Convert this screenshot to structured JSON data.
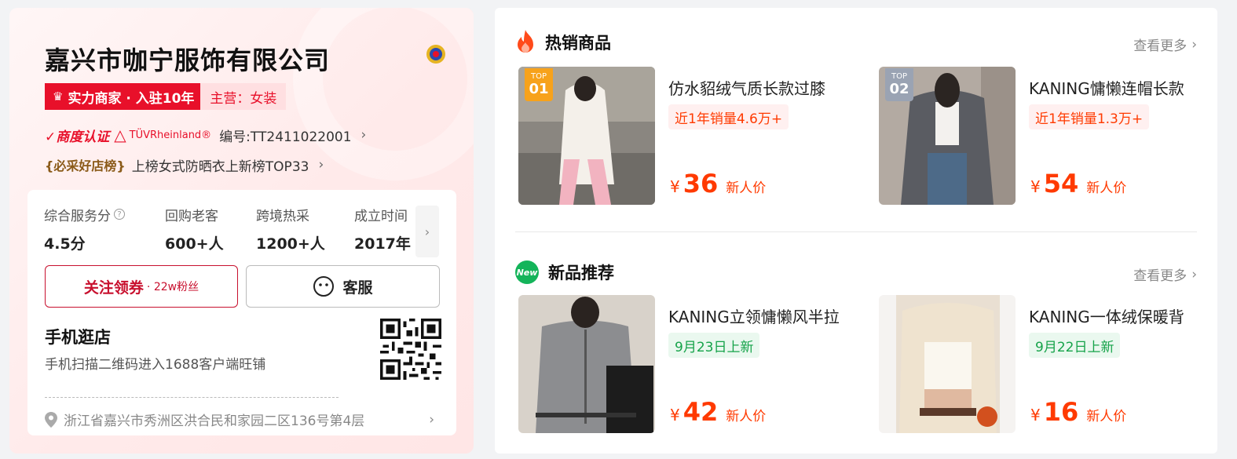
{
  "shop": {
    "name": "嘉兴市咖宁服饰有限公司",
    "strength_badge": "实力商家 · 入驻10年",
    "main_category": "主营：女装",
    "cert_mark": "✓商度认证",
    "tuv_label": "TÜVRheinland®",
    "cert_number": "编号:TT2411022001",
    "rank_mark": "{必采好店榜}",
    "rank_text": "上榜女式防晒衣上新榜TOP33",
    "stats": [
      {
        "label": "综合服务分",
        "value": "4.5分"
      },
      {
        "label": "回购老客",
        "value": "600+人"
      },
      {
        "label": "跨境热采",
        "value": "1200+人"
      },
      {
        "label": "成立时间",
        "value": "2017年"
      }
    ],
    "follow_label": "关注领券",
    "follow_sub": "· 22w粉丝",
    "service_label": "客服",
    "mobile_title": "手机逛店",
    "mobile_sub": "手机扫描二维码进入1688客户端旺铺",
    "address": "浙江省嘉兴市秀洲区洪合民和家园二区136号第4层"
  },
  "hot": {
    "title": "热销商品",
    "more": "查看更多",
    "items": [
      {
        "rank_top": "TOP",
        "rank_no": "01",
        "name": "仿水貂绒气质长款过膝",
        "sales": "近1年销量4.6万+",
        "currency": "¥",
        "price": "36",
        "price_label": "新人价"
      },
      {
        "rank_top": "TOP",
        "rank_no": "02",
        "name": "KANING慵懒连帽长款",
        "sales": "近1年销量1.3万+",
        "currency": "¥",
        "price": "54",
        "price_label": "新人价"
      }
    ]
  },
  "new": {
    "badge": "New",
    "title": "新品推荐",
    "more": "查看更多",
    "items": [
      {
        "name": "KANING立领慵懒风半拉",
        "date": "9月23日上新",
        "currency": "¥",
        "price": "42",
        "price_label": "新人价"
      },
      {
        "name": "KANING一体绒保暖背",
        "date": "9月22日上新",
        "currency": "¥",
        "price": "16",
        "price_label": "新人价"
      }
    ]
  },
  "colors": {
    "brand_red": "#e8102a",
    "price_orange": "#ff3a00",
    "new_green": "#14b45a"
  }
}
